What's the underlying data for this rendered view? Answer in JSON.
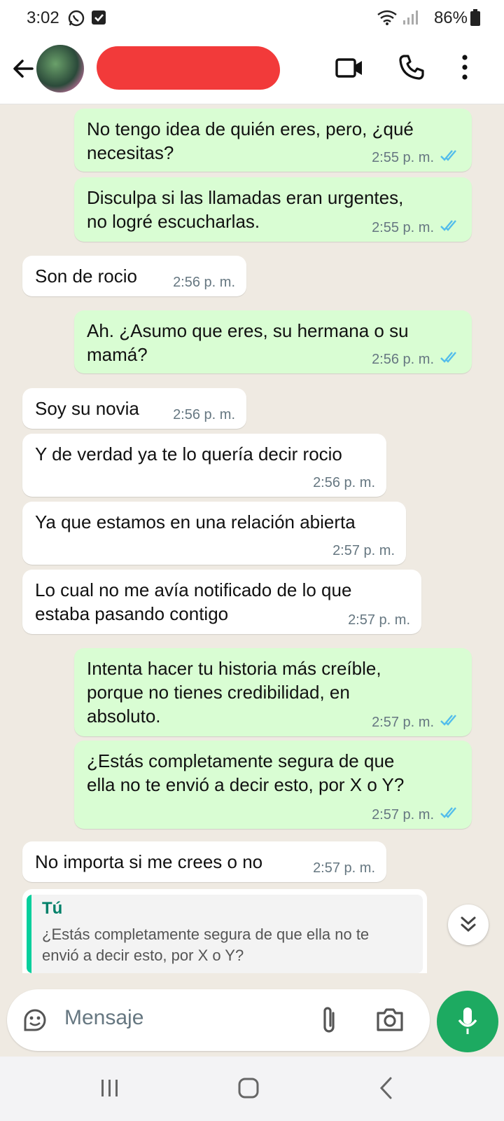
{
  "status_bar": {
    "time": "3:02",
    "battery": "86%",
    "icons": [
      "whatsapp-icon",
      "check-box-icon",
      "wifi-icon",
      "signal-icon",
      "battery-icon"
    ]
  },
  "header": {
    "icons": [
      "back-arrow-icon",
      "video-call-icon",
      "phone-icon",
      "more-vert-icon"
    ]
  },
  "messages": [
    {
      "dir": "out",
      "text": "No tengo idea de quién eres, pero, ¿qué\nnecesitas?",
      "time": "2:55 p. m."
    },
    {
      "dir": "out",
      "text": "Disculpa si las llamadas eran urgentes,\nno logré escucharlas.",
      "time": "2:55 p. m."
    },
    {
      "dir": "in",
      "text": "Son de rocio",
      "time": "2:56 p. m."
    },
    {
      "dir": "out",
      "text": "Ah. ¿Asumo que eres, su hermana o su\nmamá?",
      "time": "2:56 p. m."
    },
    {
      "dir": "in",
      "text": "Soy su novia",
      "time": "2:56 p. m."
    },
    {
      "dir": "in",
      "text": "Y de verdad ya te lo quería decir rocio",
      "time": "2:56 p. m."
    },
    {
      "dir": "in",
      "text": "Ya que estamos en una relación abierta",
      "time": "2:57 p. m."
    },
    {
      "dir": "in",
      "text": "Lo cual no me avía notificado de lo que\nestaba pasando contigo",
      "time": "2:57 p. m."
    },
    {
      "dir": "out",
      "text": "Intenta hacer tu historia más creíble,\nporque no tienes credibilidad, en\nabsoluto.",
      "time": "2:57 p. m."
    },
    {
      "dir": "out",
      "text": "¿Estás completamente segura de que\nella no te envió a decir esto, por X o Y?",
      "time": "2:57 p. m."
    },
    {
      "dir": "in",
      "text": "No importa si me crees o no",
      "time": "2:57 p. m."
    }
  ],
  "reply": {
    "sender": "Tú",
    "quote": "¿Estás completamente segura de que ella no te envió a decir esto, por X o Y?"
  },
  "composer": {
    "placeholder": "Mensaje",
    "icons": [
      "sticker-icon",
      "attach-icon",
      "camera-icon",
      "mic-icon"
    ]
  },
  "nav": {
    "icons": [
      "recent-apps-icon",
      "home-icon",
      "back-icon"
    ]
  },
  "colors": {
    "outgoing_bubble": "#d9fdd3",
    "incoming_bubble": "#ffffff",
    "chat_background": "#efeae2",
    "read_ticks": "#53bdeb",
    "accent_green": "#1daa61",
    "redaction": "#f23a3a"
  }
}
